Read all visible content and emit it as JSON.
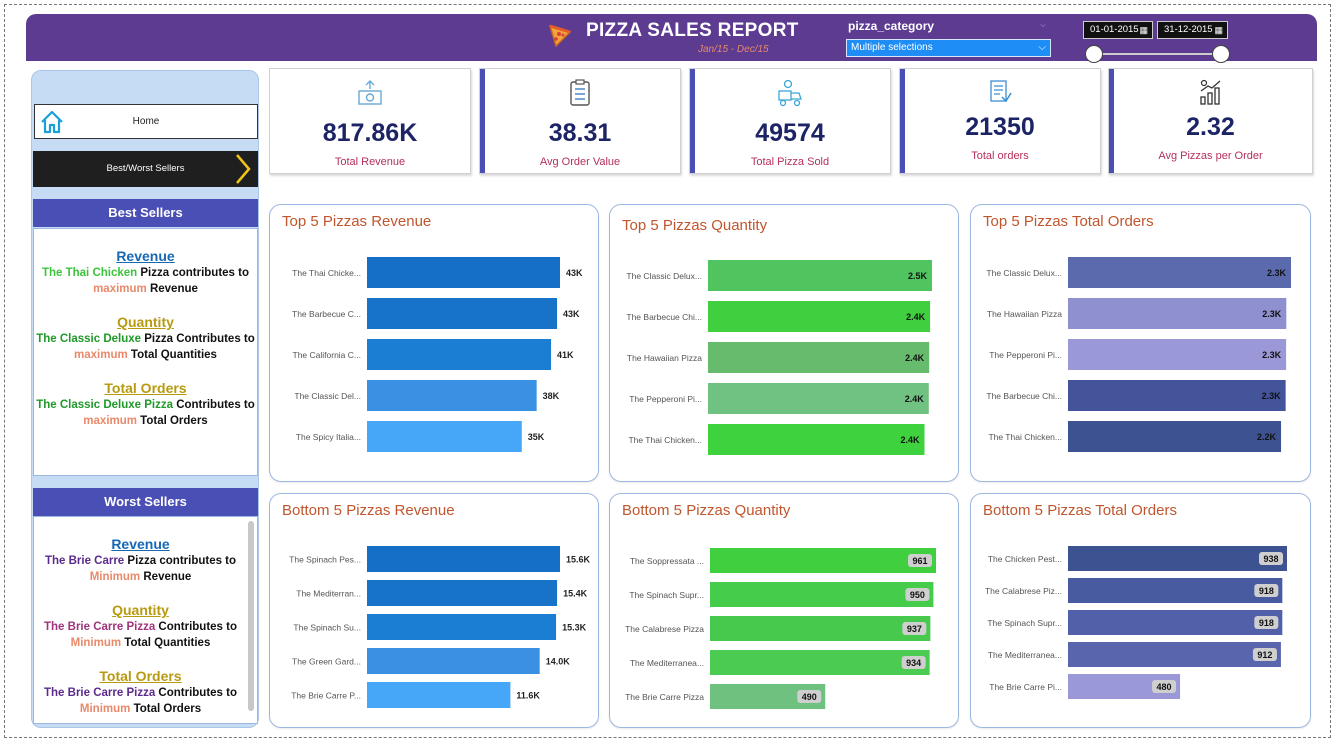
{
  "header": {
    "title": "PIZZA SALES REPORT",
    "subtitle": "Jan/15  -  Dec/15",
    "slicer_label": "pizza_category",
    "slicer_value": "Multiple selections",
    "date_start": "01-01-2015",
    "date_end": "31-12-2015",
    "colors": {
      "bar": "#5c3b91",
      "subtitle": "#e8896a",
      "slicer": "#1e8df5"
    }
  },
  "nav": {
    "home_label": "Home",
    "best_worst_label": "Best/Worst Sellers"
  },
  "best": {
    "title": "Best Sellers",
    "revenue": {
      "head": "Revenue",
      "name": "The Thai Chicken",
      "mid": " Pizza contributes to",
      "hl": "maximum",
      "tail": " Revenue"
    },
    "quantity": {
      "head": "Quantity",
      "name": "The Classic Deluxe",
      "mid": " Pizza Contributes to",
      "hl": "maximum",
      "tail": " Total Quantities"
    },
    "orders": {
      "head": "Total Orders",
      "name": "The Classic Deluxe Pizza",
      "mid": " Contributes to",
      "hl": "maximum",
      "tail": " Total Orders"
    }
  },
  "worst": {
    "title": "Worst Sellers",
    "revenue": {
      "head": "Revenue",
      "name": "The Brie Carre",
      "mid": " Pizza contributes to",
      "hl": "Minimum",
      "tail": " Revenue"
    },
    "quantity": {
      "head": "Quantity",
      "name": "The Brie Carre Pizza",
      "mid": " Contributes to",
      "hl": "Minimum",
      "tail": " Total Quantities"
    },
    "orders": {
      "head": "Total Orders",
      "name": "The Brie Carre Pizza",
      "mid": " Contributes to",
      "hl": "Minimum",
      "tail": " Total Orders"
    }
  },
  "kpis": [
    {
      "value": "817.86K",
      "label": "Total Revenue",
      "icon": "money-icon"
    },
    {
      "value": "38.31",
      "label": "Avg Order Value",
      "icon": "clipboard-icon"
    },
    {
      "value": "49574",
      "label": "Total Pizza Sold",
      "icon": "delivery-icon"
    },
    {
      "value": "21350",
      "label": "Total orders",
      "icon": "receipt-icon"
    },
    {
      "value": "2.32",
      "label": "Avg Pizzas per Order",
      "icon": "growth-chart-icon"
    }
  ],
  "chart_data": [
    {
      "type": "bar",
      "orientation": "horizontal",
      "title": "Top 5 Pizzas Revenue",
      "categories": [
        "The Thai Chicke...",
        "The Barbecue C...",
        "The California C...",
        "The Classic Del...",
        "The Spicy Italia..."
      ],
      "values": [
        43434,
        42768,
        41410,
        38180,
        34831
      ],
      "labels": [
        "43K",
        "43K",
        "41K",
        "38K",
        "35K"
      ],
      "colors": [
        "#156fc6",
        "#1773c8",
        "#1c7ed3",
        "#3a91e3",
        "#46a6f8"
      ],
      "label_position": "outside"
    },
    {
      "type": "bar",
      "orientation": "horizontal",
      "title": "Top 5 Pizzas Quantity",
      "categories": [
        "The Classic Delux...",
        "The Barbecue Chi...",
        "The Hawaiian Pizza",
        "The Pepperoni Pi...",
        "The Thai Chicken..."
      ],
      "values": [
        2453,
        2432,
        2422,
        2418,
        2371
      ],
      "labels": [
        "2.5K",
        "2.4K",
        "2.4K",
        "2.4K",
        "2.4K"
      ],
      "colors": [
        "#4fc45f",
        "#3fcf3f",
        "#66bc6c",
        "#70c283",
        "#3fd23f"
      ],
      "label_position": "inside"
    },
    {
      "type": "bar",
      "orientation": "horizontal",
      "title": "Top 5 Pizzas Total Orders",
      "categories": [
        "The Classic Delux...",
        "The Hawaiian Pizza",
        "The Pepperoni Pi...",
        "The Barbecue Chi...",
        "The Thai Chicken..."
      ],
      "values": [
        2329,
        2280,
        2278,
        2273,
        2225
      ],
      "labels": [
        "2.3K",
        "2.3K",
        "2.3K",
        "2.3K",
        "2.2K"
      ],
      "colors": [
        "#5b6aad",
        "#8e90d0",
        "#9a98d6",
        "#43549a",
        "#3d5290"
      ],
      "label_position": "inside"
    },
    {
      "type": "bar",
      "orientation": "horizontal",
      "title": "Bottom 5 Pizzas Revenue",
      "categories": [
        "The Spinach Pes...",
        "The Mediterran...",
        "The Spinach Su...",
        "The Green Gard...",
        "The Brie Carre P..."
      ],
      "values": [
        15596,
        15360,
        15278,
        13956,
        11588
      ],
      "labels": [
        "15.6K",
        "15.4K",
        "15.3K",
        "14.0K",
        "11.6K"
      ],
      "colors": [
        "#156fc6",
        "#1773c8",
        "#1c7ed3",
        "#3a91e3",
        "#46a6f8"
      ],
      "label_position": "outside"
    },
    {
      "type": "bar",
      "orientation": "horizontal",
      "title": "Bottom 5 Pizzas Quantity",
      "categories": [
        "The Soppressata ...",
        "The Spinach Supr...",
        "The Calabrese Pizza",
        "The Mediterranea...",
        "The Brie Carre Pizza"
      ],
      "values": [
        961,
        950,
        937,
        934,
        490
      ],
      "labels": [
        "961",
        "950",
        "937",
        "934",
        "490"
      ],
      "colors": [
        "#3fcf3f",
        "#44cc4a",
        "#46c94c",
        "#4ccb52",
        "#6fc180"
      ],
      "label_position": "badge"
    },
    {
      "type": "bar",
      "orientation": "horizontal",
      "title": "Bottom 5 Pizzas Total Orders",
      "categories": [
        "The Chicken Pest...",
        "The Calabrese Piz...",
        "The Spinach Supr...",
        "The Mediterranea...",
        "The Brie Carre Pi..."
      ],
      "values": [
        938,
        918,
        918,
        912,
        480
      ],
      "labels": [
        "938",
        "918",
        "918",
        "912",
        "480"
      ],
      "colors": [
        "#3d5290",
        "#485aa0",
        "#5260a9",
        "#5966ad",
        "#9a98d6"
      ],
      "label_position": "badge"
    }
  ]
}
